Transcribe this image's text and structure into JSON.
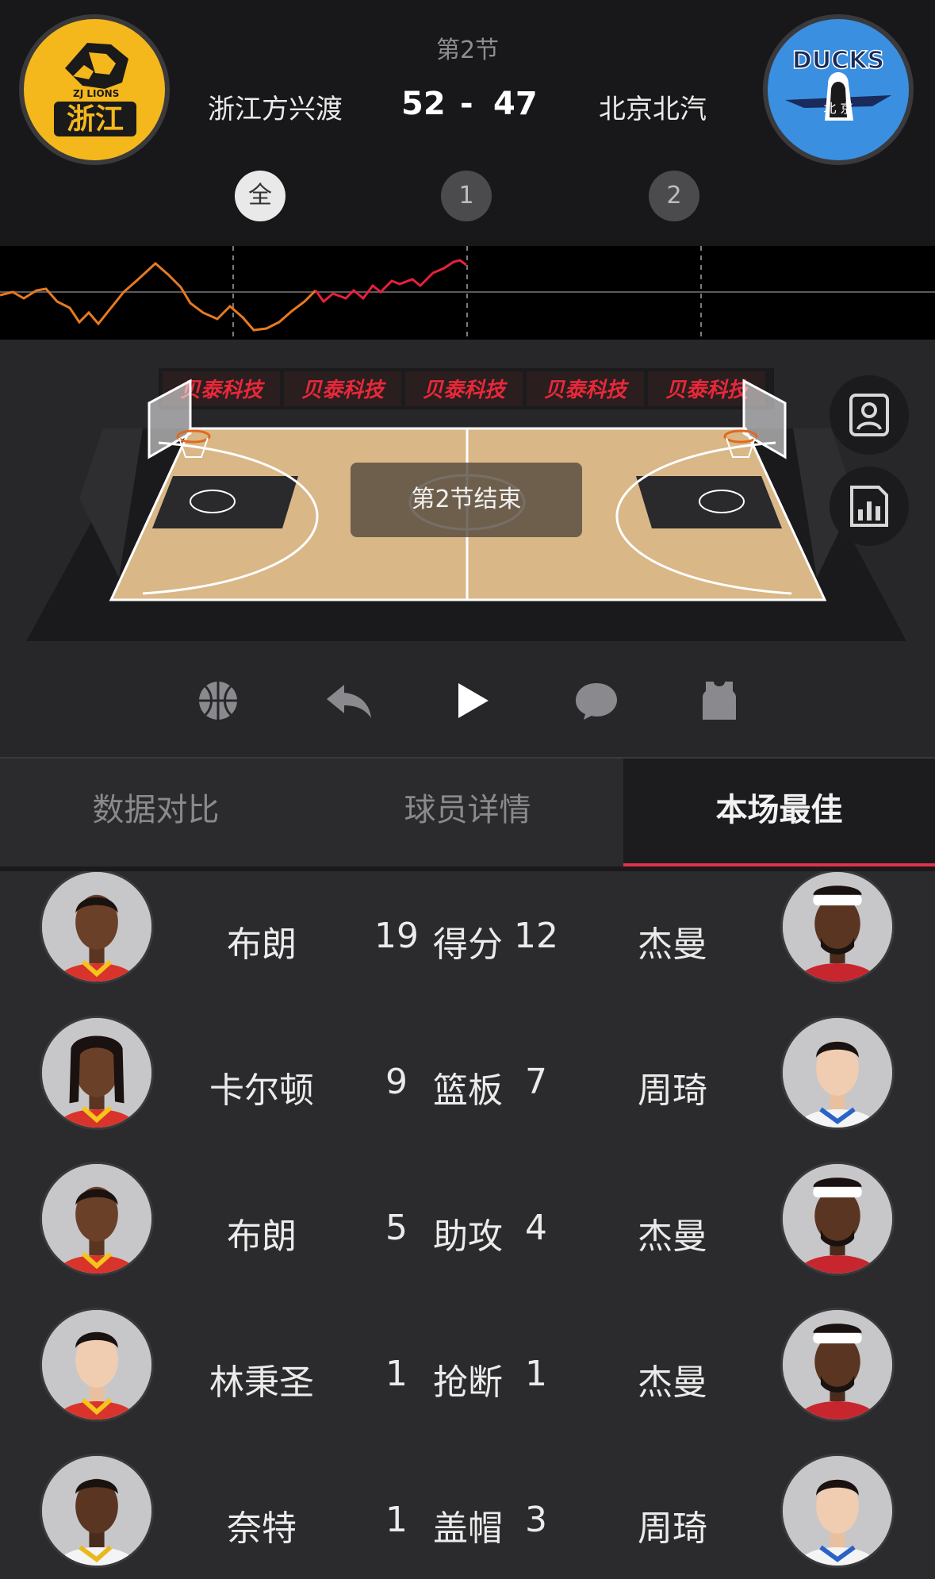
{
  "game": {
    "period": "第2节",
    "home": {
      "name": "浙江方兴渡",
      "score": "52",
      "logo_text": "浙江",
      "logo_sub": "ZJ LIONS",
      "color": "#f5b81c"
    },
    "away": {
      "name": "北京北汽",
      "score": "47",
      "logo_text": "DUCKS",
      "logo_sub": "北 京",
      "color": "#3a8fe0"
    },
    "separator": "-"
  },
  "quarter_tabs": [
    {
      "label": "全",
      "active": true
    },
    {
      "label": "1",
      "active": false
    },
    {
      "label": "2",
      "active": false
    }
  ],
  "trend": {
    "line_colors": {
      "early": "#e87a20",
      "late": "#e8203e"
    }
  },
  "court": {
    "status": "第2节结束",
    "ad_banner": [
      "贝泰科技",
      "贝泰科技",
      "贝泰科技",
      "贝泰科技",
      "贝泰科技"
    ]
  },
  "side_buttons": [
    {
      "icon": "player-card-icon"
    },
    {
      "icon": "bar-chart-icon"
    }
  ],
  "controls": [
    {
      "icon": "basketball-icon"
    },
    {
      "icon": "replay-back-icon"
    },
    {
      "icon": "play-icon"
    },
    {
      "icon": "comment-icon"
    },
    {
      "icon": "jersey-icon"
    }
  ],
  "tabs": [
    {
      "label": "数据对比",
      "active": false
    },
    {
      "label": "球员详情",
      "active": false
    },
    {
      "label": "本场最佳",
      "active": true
    }
  ],
  "best": [
    {
      "stat": "得分",
      "left": {
        "name": "布朗",
        "value": "19"
      },
      "right": {
        "name": "杰曼",
        "value": "12"
      }
    },
    {
      "stat": "篮板",
      "left": {
        "name": "卡尔顿",
        "value": "9"
      },
      "right": {
        "name": "周琦",
        "value": "7"
      }
    },
    {
      "stat": "助攻",
      "left": {
        "name": "布朗",
        "value": "5"
      },
      "right": {
        "name": "杰曼",
        "value": "4"
      }
    },
    {
      "stat": "抢断",
      "left": {
        "name": "林秉圣",
        "value": "1"
      },
      "right": {
        "name": "杰曼",
        "value": "1"
      }
    },
    {
      "stat": "盖帽",
      "left": {
        "name": "奈特",
        "value": "1"
      },
      "right": {
        "name": "周琦",
        "value": "3"
      }
    }
  ]
}
